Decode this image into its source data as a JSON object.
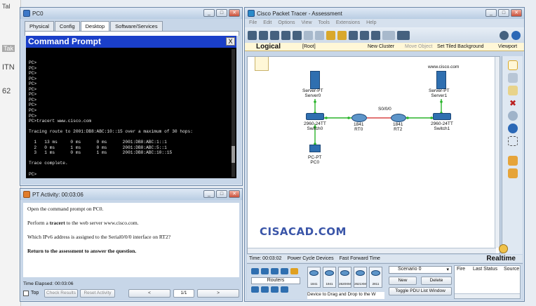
{
  "background": {
    "labels": [
      "Tal",
      "Tak",
      "ITN",
      "62"
    ]
  },
  "pc_window": {
    "title": "PC0",
    "tabs": [
      "Physical",
      "Config",
      "Desktop",
      "Software/Services"
    ],
    "active_tab": "Desktop",
    "cmd_title": "Command Prompt",
    "cmd_close": "X",
    "console_lines": [
      "PC>",
      "PC>",
      "PC>",
      "PC>",
      "PC>",
      "PC>",
      "PC>",
      "PC>",
      "PC>",
      "PC>",
      "PC>",
      "PC>tracert www.cisco.com",
      "",
      "Tracing route to 2001:DB8:ABC:10::15 over a maximum of 30 hops:",
      "",
      "  1   13 ms     0 ms      0 ms      2001:DB8:ABC:1::1",
      "  2   0 ms      1 ms      0 ms      2001:DB8:ABC:5::1",
      "  3   1 ms      0 ms      1 ms      2001:DB8:ABC:10::15",
      "",
      "Trace complete.",
      "",
      "PC>"
    ]
  },
  "activity_window": {
    "title": "PT Activity: 00:03:06",
    "instructions": [
      "Open the command prompt on PC0.",
      "Perform a tracert to the web server www.cisco.com.",
      "Which IPv6 address is assigned to the Serial0/0/0 interface on RT2?",
      "Return to the assessment to answer the question."
    ],
    "time_elapsed": "Time Elapsed: 00:03:06",
    "top_label": "Top",
    "check_results": "Check Results",
    "reset_activity": "Reset Activity",
    "prev": "<",
    "page": "1/1",
    "next": ">"
  },
  "pt_window": {
    "title": "Cisco Packet Tracer - Assessment",
    "menu": [
      "File",
      "Edit",
      "Options",
      "View",
      "Tools",
      "Extensions",
      "Help"
    ],
    "logical": "Logical",
    "root": "[Root]",
    "new_cluster": "New Cluster",
    "move_object": "Move Object",
    "set_tiled": "Set Tiled Background",
    "viewport": "Viewport",
    "watermark": "CISACAD.COM",
    "time": "Time: 00:03:02",
    "power_cycle": "Power Cycle Devices",
    "fast_forward": "Fast Forward Time",
    "realtime": "Realtime",
    "routers_label": "Routers",
    "device_hint": "Device to Drag and Drop to the W",
    "device_models": [
      "1841",
      "1941",
      "2620XM",
      "2621XM",
      "2811"
    ],
    "scenario": "Scenario 0",
    "new_btn": "New",
    "delete_btn": "Delete",
    "toggle_pdu": "Toggle PDU List Window",
    "pdu_cols": [
      "Fire",
      "Last Status",
      "Source"
    ],
    "devices": {
      "server0": [
        "Server-PT",
        "Server0"
      ],
      "server1": [
        "Server-PT",
        "Server1"
      ],
      "server1_host": "www.cisco.com",
      "switch0": [
        "2960-24TT",
        "Switch0"
      ],
      "switch1": [
        "2960-24TT",
        "Switch1"
      ],
      "rt0": [
        "1841",
        "RT0"
      ],
      "rt2": [
        "1841",
        "RT2"
      ],
      "pc0": [
        "PC-PT",
        "PC0"
      ],
      "serial_label": "S0/0/0"
    }
  },
  "colors": {
    "link_green": "#29b42a",
    "cmd_blue": "#1a3fc9",
    "device_blue": "#2f6fb0"
  }
}
